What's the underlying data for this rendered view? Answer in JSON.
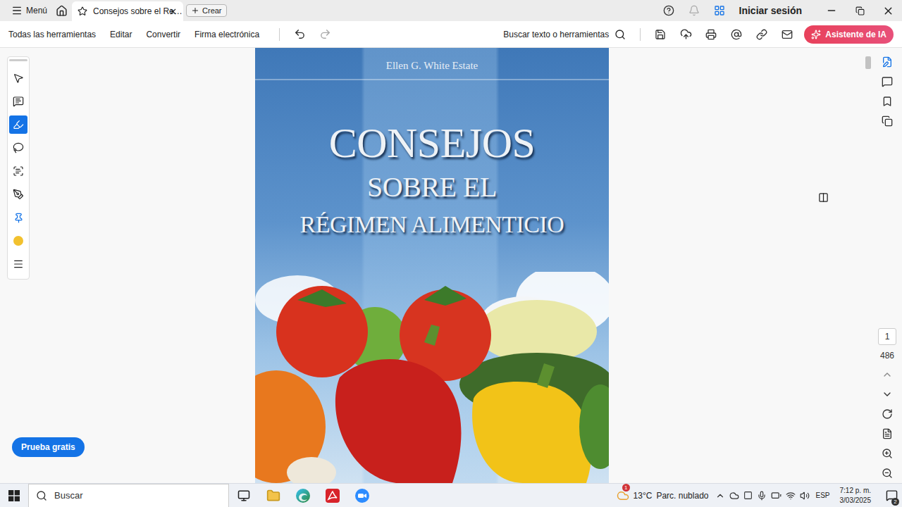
{
  "app_bar": {
    "menu": "Menú",
    "tab": {
      "title": "Consejos sobre el Re…",
      "selected": true
    },
    "create": "Crear",
    "sign_in": "Iniciar sesión"
  },
  "toolbar": {
    "items": [
      "Todas las herramientas",
      "Editar",
      "Convertir",
      "Firma electrónica"
    ],
    "search": "Buscar texto o herramientas",
    "ai_button": "Asistente de IA"
  },
  "tool_rail": {
    "tools": [
      {
        "kind": "select",
        "selected": false
      },
      {
        "kind": "comment",
        "selected": false
      },
      {
        "kind": "highlight",
        "selected": true
      },
      {
        "kind": "draw",
        "selected": false
      },
      {
        "kind": "text",
        "selected": false
      },
      {
        "kind": "sign",
        "selected": false
      },
      {
        "kind": "pin",
        "selected": false
      },
      {
        "kind": "color",
        "selected": false
      },
      {
        "kind": "more",
        "selected": false
      }
    ],
    "swatch": "#f2c12e"
  },
  "document": {
    "header": "Ellen G. White Estate",
    "title": [
      "CONSEJOS",
      "SOBRE EL",
      "RÉGIMEN ALIMENTICIO"
    ]
  },
  "page_nav": {
    "current": "1",
    "total": "486"
  },
  "trial_button": "Prueba gratis",
  "taskbar": {
    "search": "Buscar",
    "apps": [
      {
        "kind": "taskview"
      },
      {
        "kind": "explorer"
      },
      {
        "kind": "edge"
      },
      {
        "kind": "acrobat"
      },
      {
        "kind": "zoom"
      }
    ],
    "weather": {
      "temp": "13°C",
      "text": "Parc. nublado",
      "badge": "1"
    },
    "language": "ESP",
    "time": "7:12 p. m.",
    "date": "3/03/2025",
    "notifications": "2"
  }
}
